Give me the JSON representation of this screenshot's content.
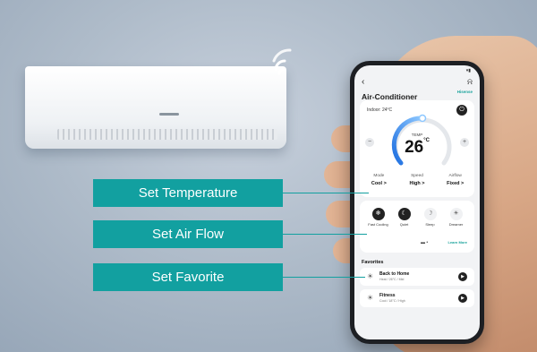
{
  "callouts": {
    "set_temperature": "Set Temperature",
    "set_air_flow": "Set Air Flow",
    "set_favorite": "Set Favorite"
  },
  "app": {
    "status_right": "▾▮",
    "back_icon": "‹",
    "bell_icon": "⍾",
    "title": "Air-Conditioner",
    "brand": "Hisense",
    "indoor": "Indoor: 24°C",
    "power_icon": "⏻",
    "temp_label": "TEMP",
    "temp_value": "26",
    "temp_unit": "°C",
    "minus": "−",
    "plus": "+",
    "modes": [
      {
        "name": "Mode",
        "value": "Cool >"
      },
      {
        "name": "Speed",
        "value": "High >"
      },
      {
        "name": "Airflow",
        "value": "Fixed >"
      }
    ],
    "flows": [
      {
        "name": "Fast Cooling",
        "icon": "❄",
        "active": true
      },
      {
        "name": "Quiet",
        "icon": "☾",
        "active": true
      },
      {
        "name": "Sleep",
        "icon": "☽",
        "active": false
      },
      {
        "name": "Dreamer",
        "icon": "☀",
        "active": false
      }
    ],
    "pager": "▬ •",
    "learn_more": "Learn More",
    "favorites_title": "Favorites",
    "favorites": [
      {
        "name": "Back to Home",
        "sub": "Heat / 26°C / Mid",
        "icon": "☀"
      },
      {
        "name": "Fitness",
        "sub": "Cool / 18°C / High",
        "icon": "☀"
      }
    ],
    "play_icon": "▶"
  },
  "colors": {
    "accent": "#12a0a0",
    "dial_from": "#1e6fe0",
    "dial_to": "#8ec8ff"
  }
}
